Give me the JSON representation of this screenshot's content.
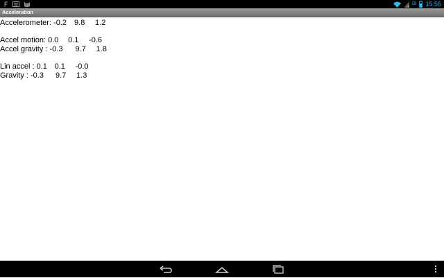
{
  "status_bar": {
    "time": "15:55",
    "battery_percent": "59",
    "left_icons": [
      "notification-f-icon",
      "keyboard-icon",
      "cat-app-icon"
    ],
    "right_icons": [
      "wifi-icon",
      "signal-icon",
      "battery-icon"
    ]
  },
  "title_bar": {
    "title": "Acceleration"
  },
  "readings": {
    "accelerometer": {
      "label": "Accelerometer: ",
      "x": "-0.2",
      "y": "9.8",
      "z": "1.2"
    },
    "accel_motion": {
      "label": "Accel motion: ",
      "x": "0.0",
      "y": "0.1",
      "z": "-0.6"
    },
    "accel_gravity": {
      "label": "Accel gravity : ",
      "x": "-0.3",
      "y": "9.7",
      "z": "1.8"
    },
    "lin_accel": {
      "label": "Lin accel : ",
      "x": "0.1",
      "y": "0.1",
      "z": "-0.0"
    },
    "gravity": {
      "label": "Gravity : ",
      "x": "-0.3",
      "y": "9.7",
      "z": "1.3"
    }
  },
  "nav_bar": {
    "buttons": [
      "back-icon",
      "home-icon",
      "recents-icon",
      "overflow-menu-icon"
    ]
  }
}
